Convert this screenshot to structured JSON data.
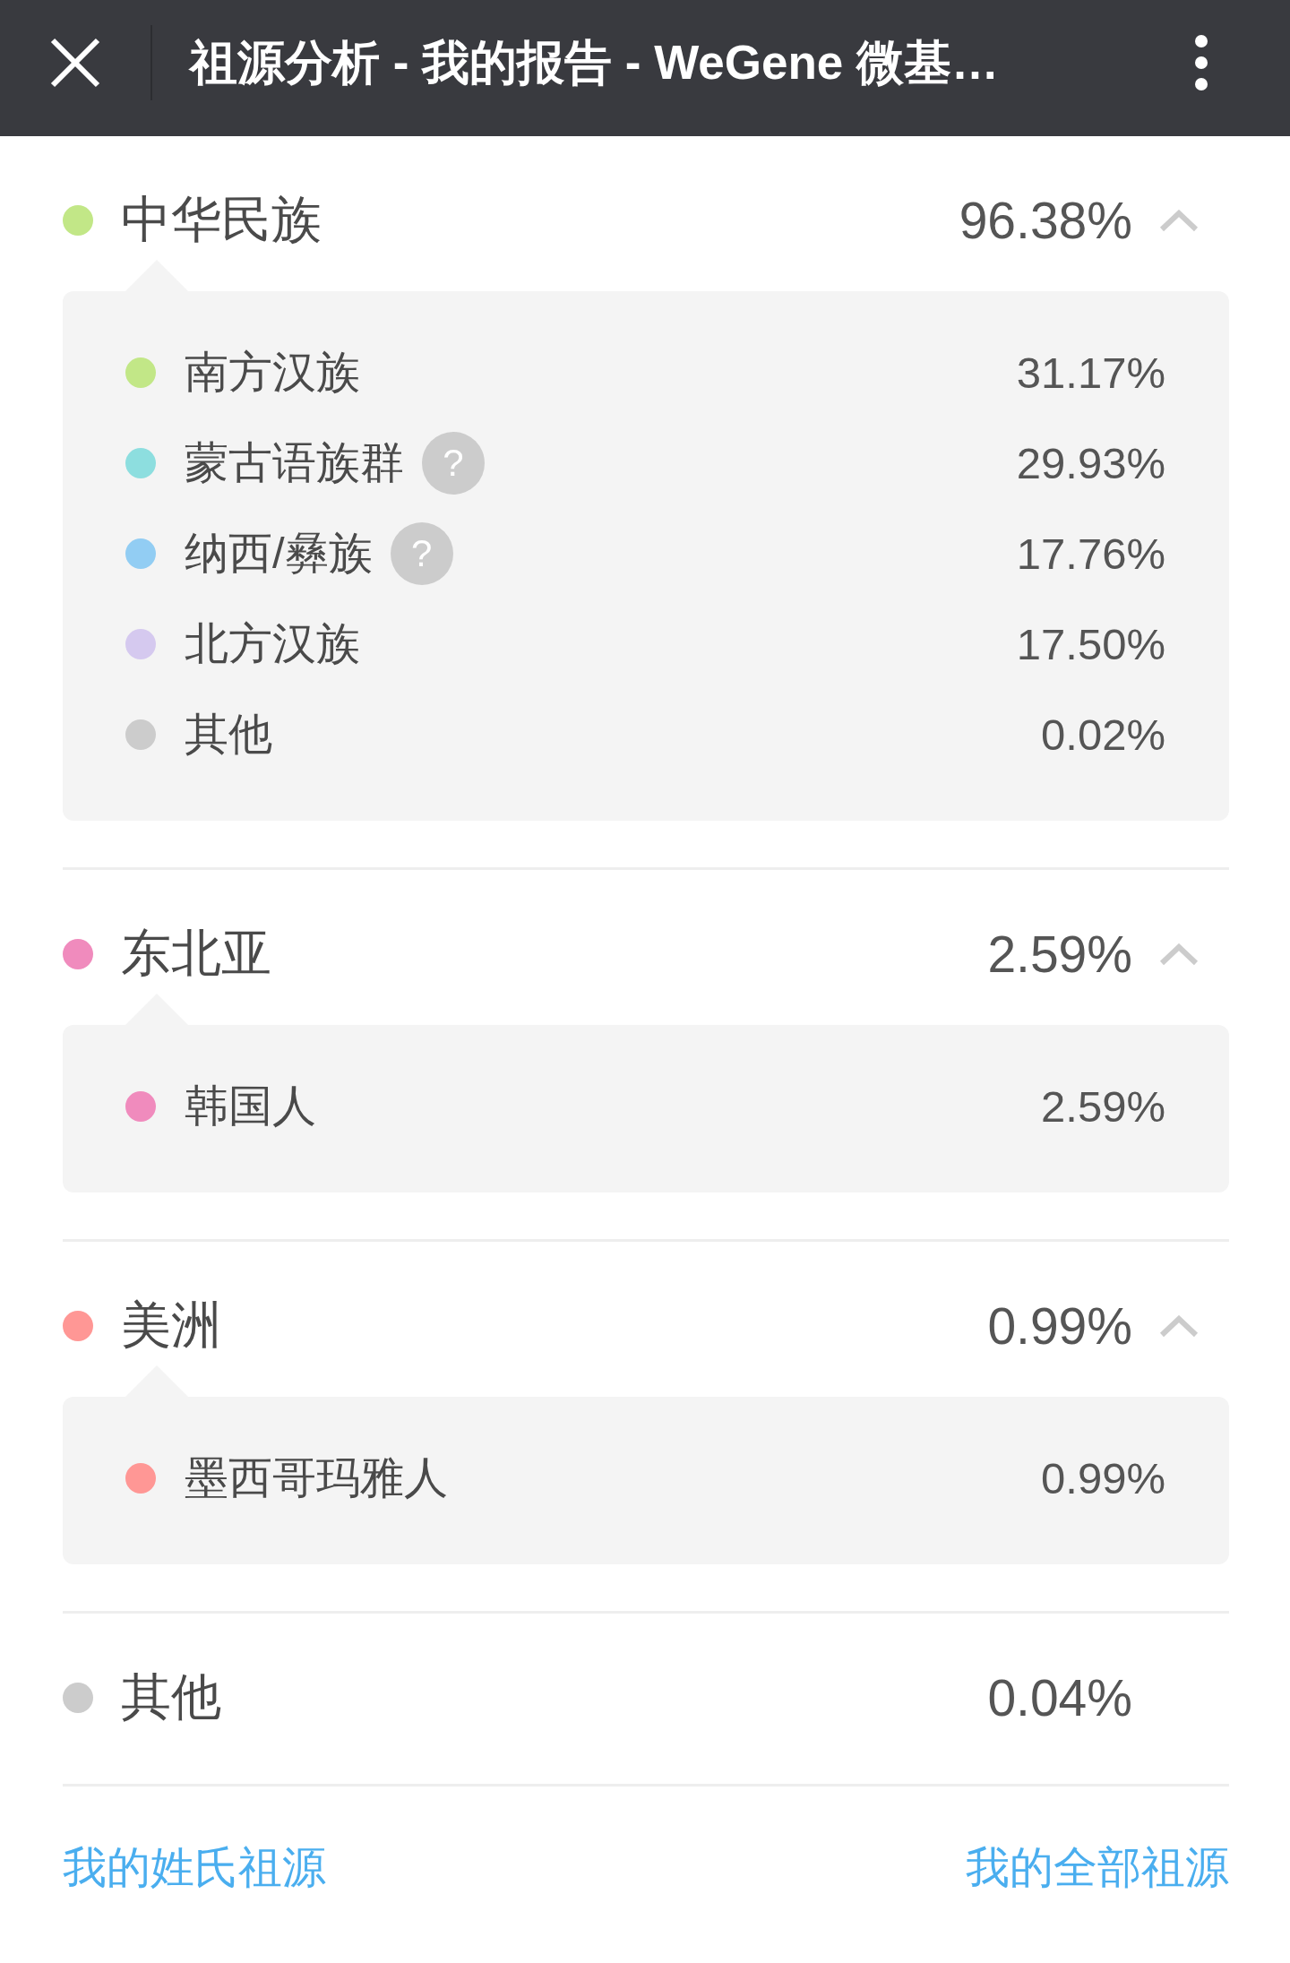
{
  "app_bar": {
    "title": "祖源分析 - 我的报告 - WeGene 微基…"
  },
  "groups": [
    {
      "kind": "expandable",
      "name": "中华民族",
      "color": "#c2e787",
      "percent": "96.38%",
      "expanded": true,
      "regions": [
        {
          "name": "南方汉族",
          "color": "#c2e787",
          "percent": "31.17%"
        },
        {
          "name": "蒙古语族群",
          "color": "#8ddedf",
          "percent": "29.93%",
          "help": "?"
        },
        {
          "name": "纳西/彝族",
          "color": "#92cdf3",
          "percent": "17.76%",
          "help": "?"
        },
        {
          "name": "北方汉族",
          "color": "#d5c9ef",
          "percent": "17.50%"
        },
        {
          "name": "其他",
          "color": "#cccccc",
          "percent": "0.02%"
        }
      ]
    },
    {
      "kind": "expandable",
      "name": "东北亚",
      "color": "#f08bbd",
      "percent": "2.59%",
      "expanded": true,
      "regions": [
        {
          "name": "韩国人",
          "color": "#f08bbd",
          "percent": "2.59%"
        }
      ]
    },
    {
      "kind": "expandable",
      "name": "美洲",
      "color": "#ff9795",
      "percent": "0.99%",
      "expanded": true,
      "regions": [
        {
          "name": "墨西哥玛雅人",
          "color": "#ff9795",
          "percent": "0.99%"
        }
      ]
    },
    {
      "kind": "plain",
      "name": "其他",
      "color": "#cccccc",
      "percent": "0.04%"
    }
  ],
  "footer_links": [
    "我的姓氏祖源",
    "我的全部祖源"
  ]
}
